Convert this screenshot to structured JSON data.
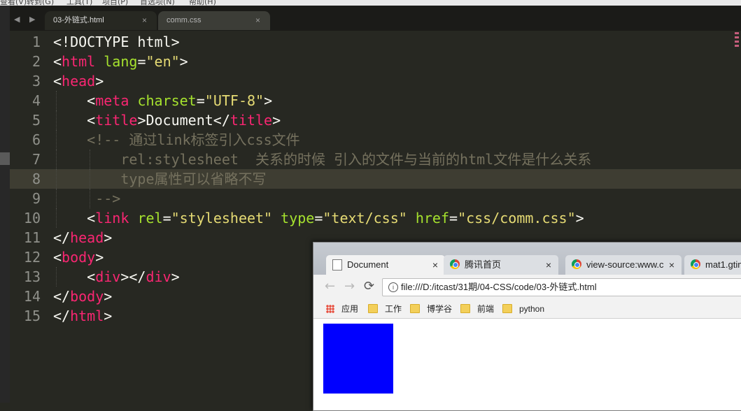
{
  "menubar": [
    "查看(V)",
    "转到(G)",
    "工具(T)",
    "项目(P)",
    "首选项(N)",
    "帮助(H)"
  ],
  "editor": {
    "tabs": [
      {
        "label": "03-外链式.html",
        "close": "×"
      },
      {
        "label": "comm.css",
        "close": "×"
      }
    ],
    "nav_arrows": "◀ ▶",
    "current_line": 8,
    "lines": [
      {
        "n": "1",
        "indent": "",
        "tokens": [
          {
            "c": "p",
            "t": "<!DOCTYPE html>"
          }
        ]
      },
      {
        "n": "2",
        "indent": "",
        "tokens": [
          {
            "c": "p",
            "t": "<"
          },
          {
            "c": "t",
            "t": "html"
          },
          {
            "c": "p",
            "t": " "
          },
          {
            "c": "a",
            "t": "lang"
          },
          {
            "c": "p",
            "t": "="
          },
          {
            "c": "s",
            "t": "\"en\""
          },
          {
            "c": "p",
            "t": ">"
          }
        ]
      },
      {
        "n": "3",
        "indent": "",
        "tokens": [
          {
            "c": "p",
            "t": "<"
          },
          {
            "c": "t",
            "t": "head"
          },
          {
            "c": "p",
            "t": ">"
          }
        ]
      },
      {
        "n": "4",
        "indent": "    ",
        "tokens": [
          {
            "c": "p",
            "t": "<"
          },
          {
            "c": "t",
            "t": "meta"
          },
          {
            "c": "p",
            "t": " "
          },
          {
            "c": "a",
            "t": "charset"
          },
          {
            "c": "p",
            "t": "="
          },
          {
            "c": "s",
            "t": "\"UTF-8\""
          },
          {
            "c": "p",
            "t": ">"
          }
        ]
      },
      {
        "n": "5",
        "indent": "    ",
        "tokens": [
          {
            "c": "p",
            "t": "<"
          },
          {
            "c": "t",
            "t": "title"
          },
          {
            "c": "p",
            "t": ">Document</"
          },
          {
            "c": "t",
            "t": "title"
          },
          {
            "c": "p",
            "t": ">"
          }
        ]
      },
      {
        "n": "6",
        "indent": "    ",
        "tokens": [
          {
            "c": "c",
            "t": "<!-- 通过link标签引入css文件"
          }
        ]
      },
      {
        "n": "7",
        "indent": "        ",
        "tokens": [
          {
            "c": "c",
            "t": "rel:stylesheet  关系的时候 引入的文件与当前的html文件是什么关系"
          }
        ]
      },
      {
        "n": "8",
        "indent": "        ",
        "tokens": [
          {
            "c": "c",
            "t": "type属性可以省略不写"
          }
        ]
      },
      {
        "n": "9",
        "indent": "     ",
        "tokens": [
          {
            "c": "c",
            "t": "-->"
          }
        ]
      },
      {
        "n": "10",
        "indent": "    ",
        "tokens": [
          {
            "c": "p",
            "t": "<"
          },
          {
            "c": "t",
            "t": "link"
          },
          {
            "c": "p",
            "t": " "
          },
          {
            "c": "a",
            "t": "rel"
          },
          {
            "c": "p",
            "t": "="
          },
          {
            "c": "s",
            "t": "\"stylesheet\""
          },
          {
            "c": "p",
            "t": " "
          },
          {
            "c": "a",
            "t": "type"
          },
          {
            "c": "p",
            "t": "="
          },
          {
            "c": "s",
            "t": "\"text/css\""
          },
          {
            "c": "p",
            "t": " "
          },
          {
            "c": "a",
            "t": "href"
          },
          {
            "c": "p",
            "t": "="
          },
          {
            "c": "s",
            "t": "\"css/comm.css\""
          },
          {
            "c": "p",
            "t": ">"
          }
        ]
      },
      {
        "n": "11",
        "indent": "",
        "tokens": [
          {
            "c": "p",
            "t": "</"
          },
          {
            "c": "t",
            "t": "head"
          },
          {
            "c": "p",
            "t": ">"
          }
        ]
      },
      {
        "n": "12",
        "indent": "",
        "tokens": [
          {
            "c": "p",
            "t": "<"
          },
          {
            "c": "t",
            "t": "body"
          },
          {
            "c": "p",
            "t": ">"
          }
        ]
      },
      {
        "n": "13",
        "indent": "    ",
        "tokens": [
          {
            "c": "p",
            "t": "<"
          },
          {
            "c": "t",
            "t": "div"
          },
          {
            "c": "p",
            "t": "></"
          },
          {
            "c": "t",
            "t": "div"
          },
          {
            "c": "p",
            "t": ">"
          }
        ]
      },
      {
        "n": "14",
        "indent": "",
        "tokens": [
          {
            "c": "p",
            "t": "</"
          },
          {
            "c": "t",
            "t": "body"
          },
          {
            "c": "p",
            "t": ">"
          }
        ]
      },
      {
        "n": "15",
        "indent": "",
        "tokens": [
          {
            "c": "p",
            "t": "</"
          },
          {
            "c": "t",
            "t": "html"
          },
          {
            "c": "p",
            "t": ">"
          }
        ]
      }
    ]
  },
  "browser": {
    "tabs": [
      {
        "label": "Document",
        "icon": "document-icon",
        "close": "×"
      },
      {
        "label": "腾讯首页",
        "icon": "chrome-icon",
        "close": "×"
      },
      {
        "label": "view-source:www.c",
        "icon": "chrome-icon",
        "close": "×"
      },
      {
        "label": "mat1.gtim",
        "icon": "chrome-icon",
        "close": "×"
      }
    ],
    "back": "←",
    "forward": "→",
    "reload": "⟳",
    "info": "i",
    "url": "file:///D:/itcast/31期/04-CSS/code/03-外链式.html",
    "bookmarks": [
      {
        "label": "应用",
        "icon": "apps-icon"
      },
      {
        "label": "工作",
        "icon": "folder-icon"
      },
      {
        "label": "博学谷",
        "icon": "folder-icon"
      },
      {
        "label": "前端",
        "icon": "folder-icon"
      },
      {
        "label": "python",
        "icon": "folder-icon"
      }
    ],
    "page_box_color": "#0000ff"
  }
}
